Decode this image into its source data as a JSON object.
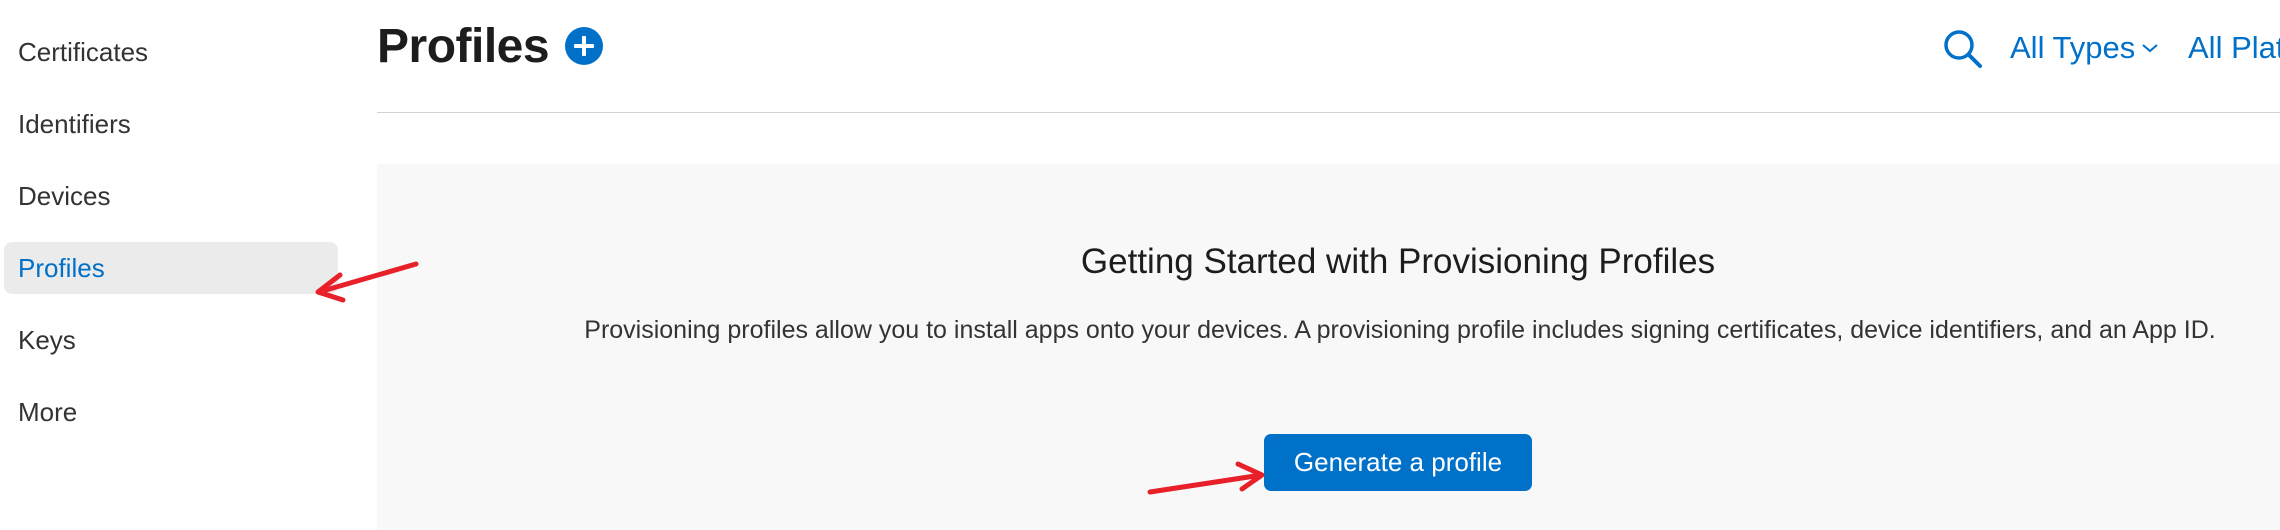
{
  "sidebar": {
    "items": [
      {
        "label": "Certificates",
        "active": false
      },
      {
        "label": "Identifiers",
        "active": false
      },
      {
        "label": "Devices",
        "active": false
      },
      {
        "label": "Profiles",
        "active": true
      },
      {
        "label": "Keys",
        "active": false
      },
      {
        "label": "More",
        "active": false
      }
    ]
  },
  "header": {
    "title": "Profiles",
    "add_icon": "plus-circle-icon",
    "search_icon": "search-icon",
    "filters": {
      "types_label": "All Types",
      "platforms_label": "All Platf"
    }
  },
  "getting_started": {
    "heading": "Getting Started with Provisioning Profiles",
    "description": "Provisioning profiles allow you to install apps onto your devices. A provisioning profile includes signing certificates, device identifiers, and an App ID.",
    "button_label": "Generate a profile"
  },
  "colors": {
    "accent": "#0070c9",
    "active_item_bg": "#ebebeb",
    "panel_bg": "#f8f8f8",
    "annotation_arrow": "#e8202a"
  }
}
